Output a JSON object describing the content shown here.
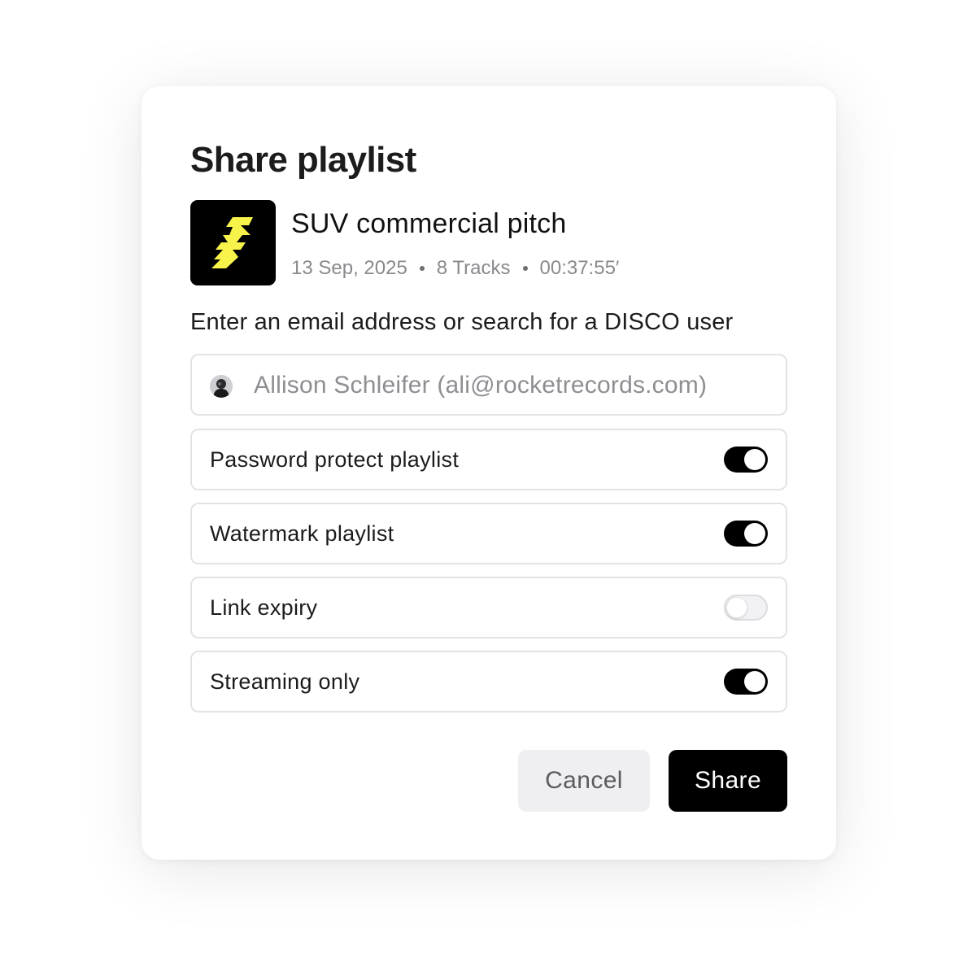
{
  "dialog": {
    "title": "Share playlist"
  },
  "playlist": {
    "name": "SUV commercial pitch",
    "date": "13 Sep, 2025",
    "tracks": "8 Tracks",
    "duration": "00:37:55′",
    "cover_icon": "lightning-bolt-icon",
    "cover_colors": {
      "background": "#000000",
      "icon": "#f7f34b"
    }
  },
  "share": {
    "prompt": "Enter an email address or search for a DISCO user",
    "recipient": "Allison Schleifer (ali@rocketrecords.com)",
    "recipient_avatar": "user-avatar"
  },
  "options": [
    {
      "label": "Password protect playlist",
      "enabled": true
    },
    {
      "label": "Watermark playlist",
      "enabled": true
    },
    {
      "label": "Link expiry",
      "enabled": false
    },
    {
      "label": "Streaming only",
      "enabled": true
    }
  ],
  "actions": {
    "cancel_label": "Cancel",
    "share_label": "Share"
  }
}
